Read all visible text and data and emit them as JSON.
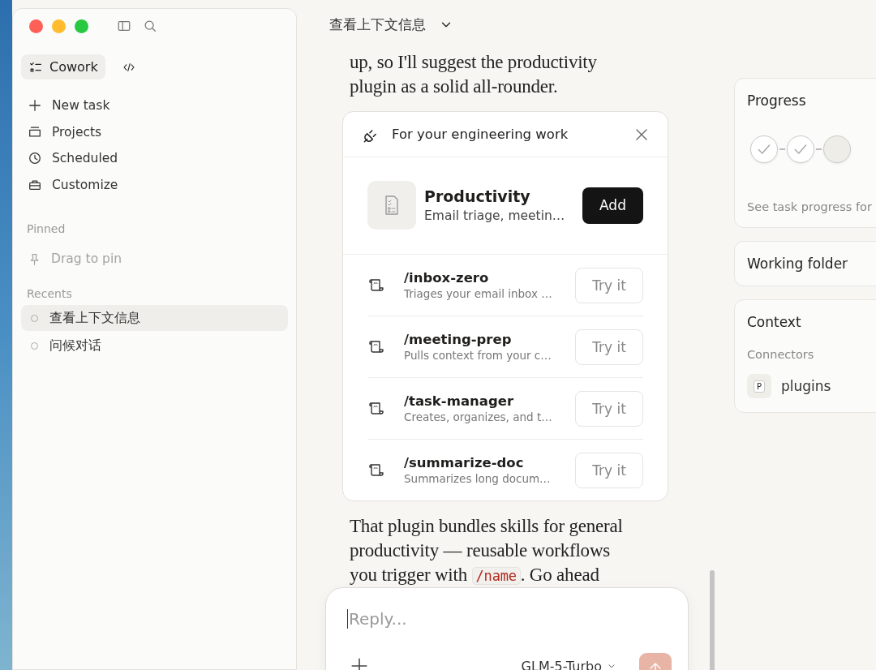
{
  "sidebar": {
    "mode_tabs": [
      {
        "label": "Cowork",
        "kind": "cowork",
        "selected": true
      },
      {
        "kind": "code",
        "selected": false
      }
    ],
    "nav": [
      {
        "label": "New task",
        "kind": "plus"
      },
      {
        "label": "Projects",
        "kind": "folder"
      },
      {
        "label": "Scheduled",
        "kind": "clock"
      },
      {
        "label": "Customize",
        "kind": "briefcase"
      }
    ],
    "pinned": {
      "title": "Pinned",
      "hint": "Drag to pin"
    },
    "recents": {
      "title": "Recents",
      "items": [
        {
          "label": "查看上下文信息",
          "selected": true
        },
        {
          "label": "问候对话",
          "selected": false
        }
      ]
    }
  },
  "header": {
    "title": "查看上下文信息"
  },
  "chat": {
    "intro": "up, so I'll suggest the productivity plugin as a solid all-rounder.",
    "suggestion": {
      "title": "For your engineering work",
      "plugin": {
        "name": "Productivity",
        "description": "Email triage, meetin…",
        "action": "Add"
      },
      "skills": [
        {
          "name": "/inbox-zero",
          "description": "Triages your email inbox …",
          "action": "Try it"
        },
        {
          "name": "/meeting-prep",
          "description": "Pulls context from your c…",
          "action": "Try it"
        },
        {
          "name": "/task-manager",
          "description": "Creates, organizes, and t…",
          "action": "Try it"
        },
        {
          "name": "/summarize-doc",
          "description": "Summarizes long docum…",
          "action": "Try it"
        }
      ]
    },
    "followup": {
      "text_before": "That plugin bundles skills for general productivity — reusable workflows you trigger with",
      "code": "/name",
      "text_after": ". Go ahead"
    }
  },
  "composer": {
    "placeholder": "Reply...",
    "model": "GLM-5-Turbo"
  },
  "panel": {
    "progress": {
      "title": "Progress",
      "steps": [
        {
          "done": true
        },
        {
          "done": true
        },
        {
          "done": false
        }
      ],
      "caption": "See task progress for"
    },
    "working_folder": {
      "title": "Working folder"
    },
    "context": {
      "title": "Context",
      "section": "Connectors",
      "connectors": [
        {
          "badge": "P",
          "name": "plugins"
        }
      ]
    }
  }
}
